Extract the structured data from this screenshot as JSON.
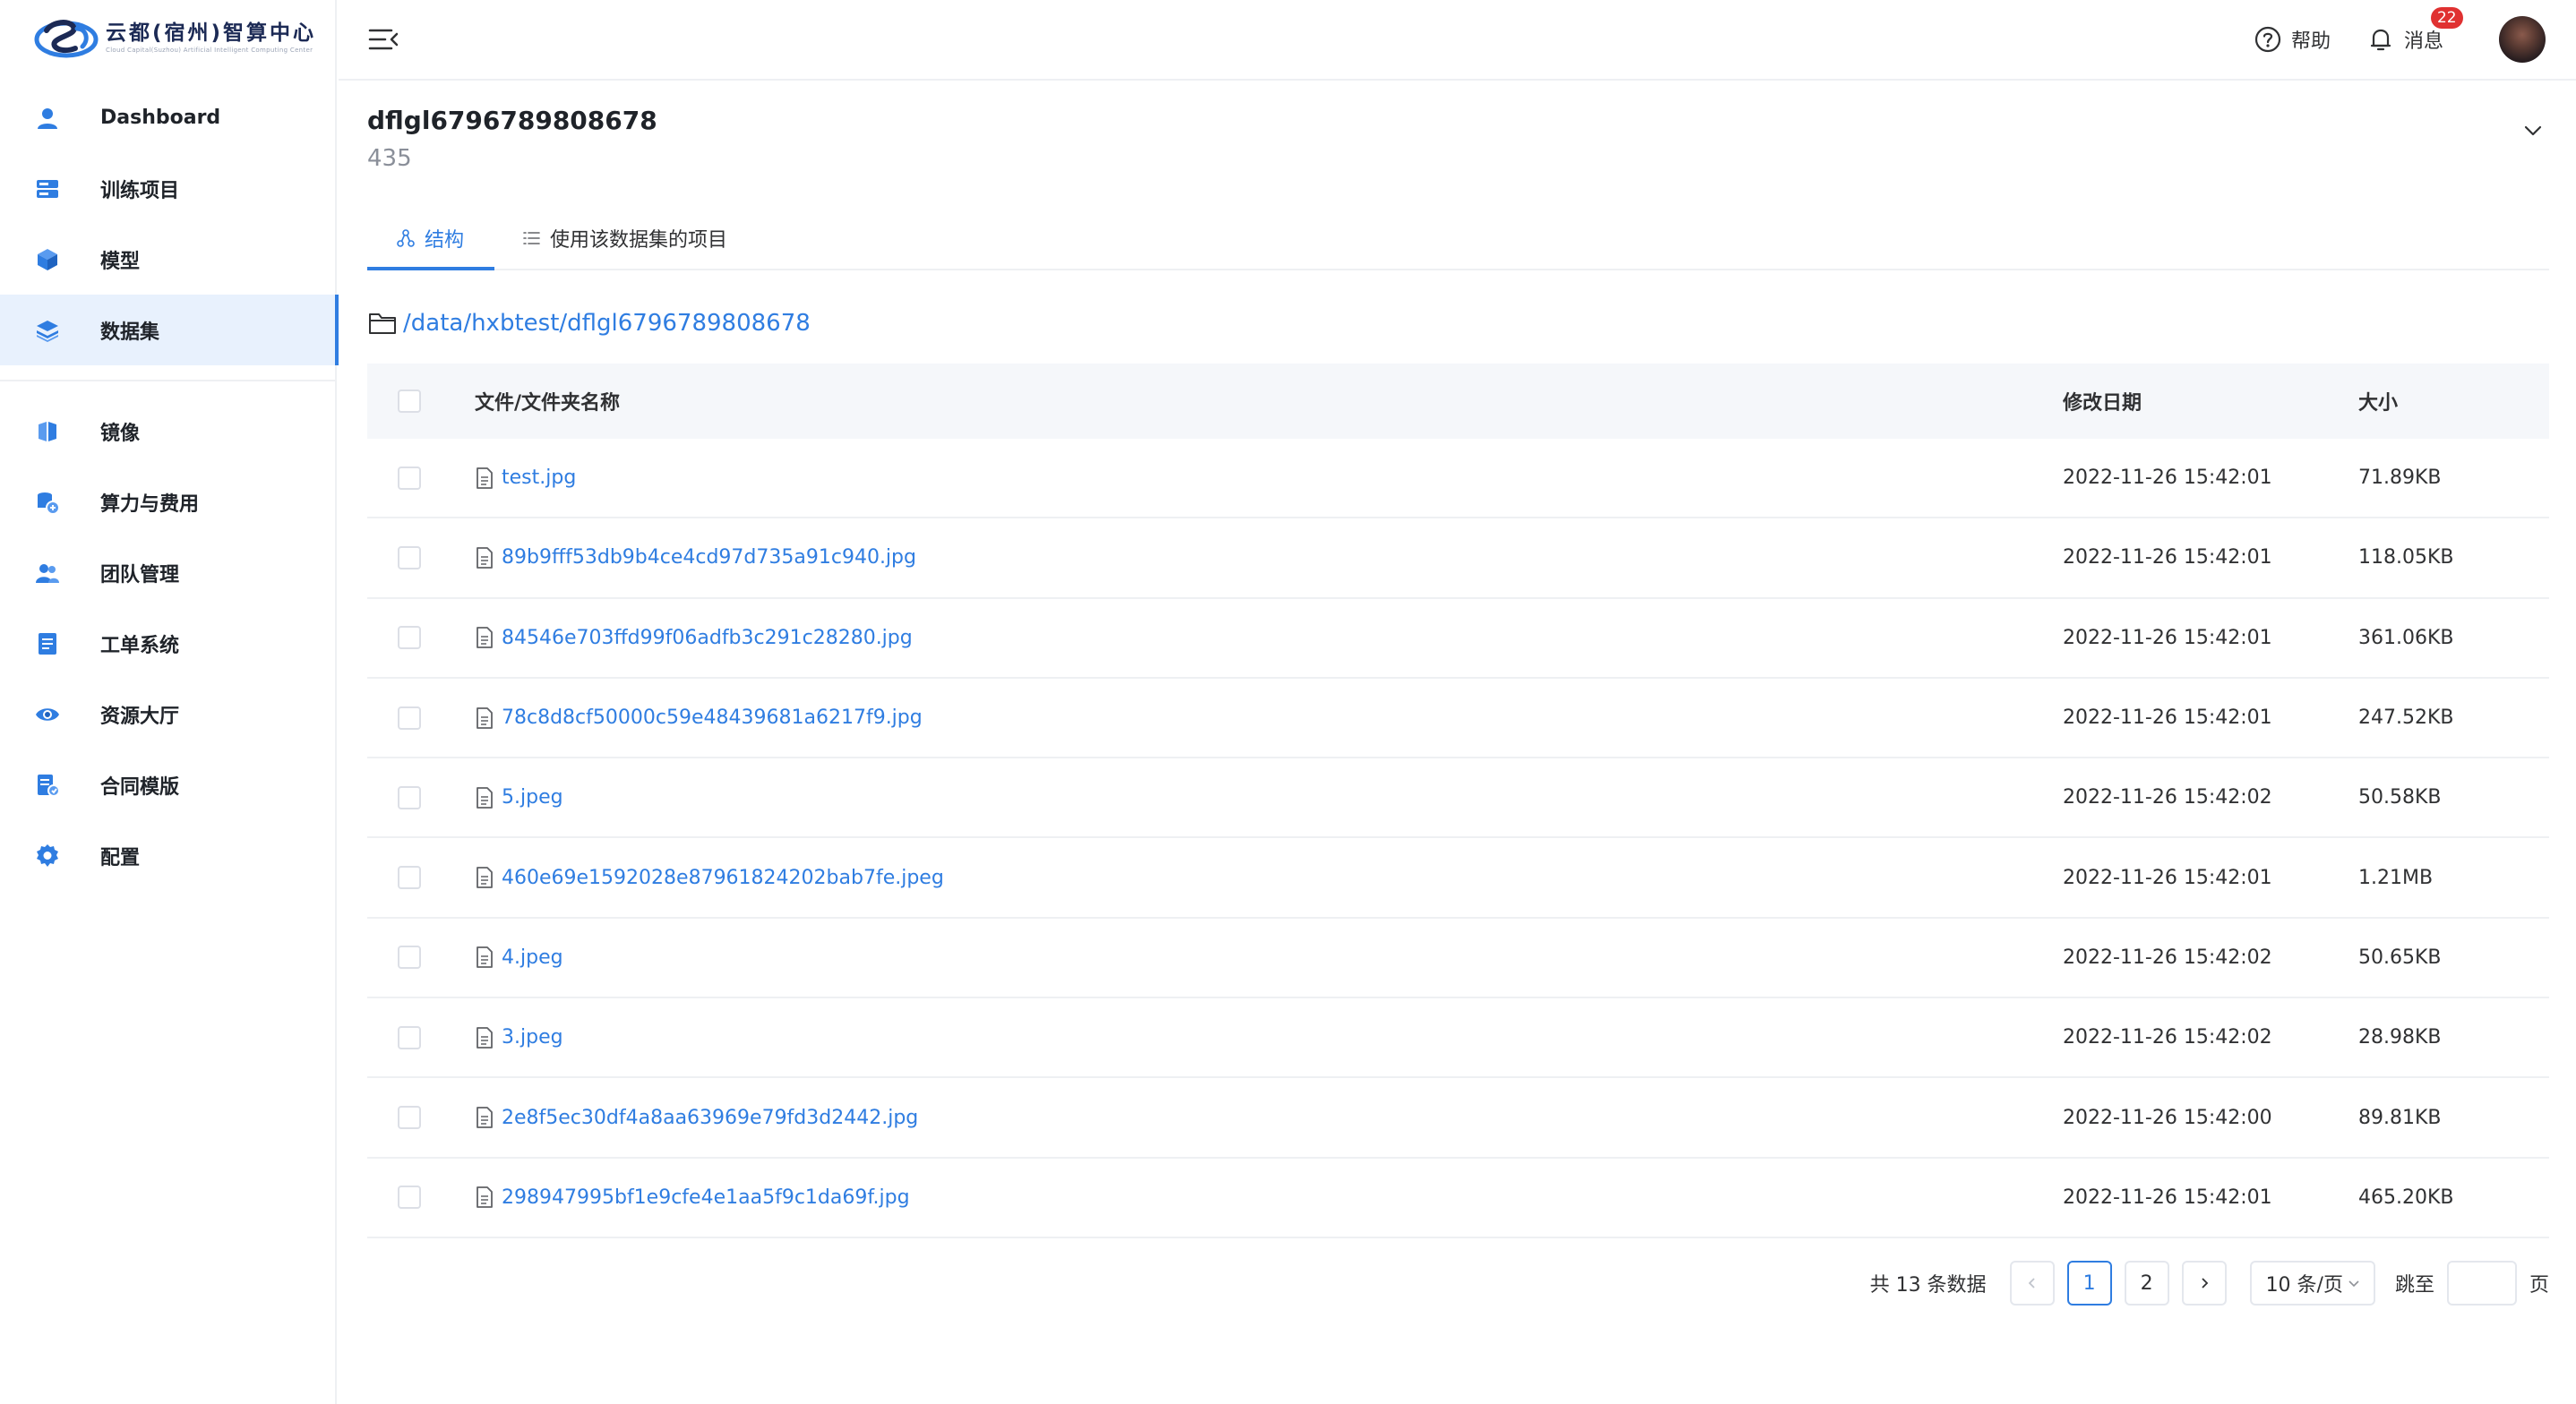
{
  "brand": {
    "title": "云都(宿州)智算中心",
    "subtitle": "Cloud Capital(Suzhou) Artificial Intelligent Computing Center"
  },
  "sidebar": {
    "items": [
      {
        "label": "Dashboard",
        "icon": "user-icon"
      },
      {
        "label": "训练项目",
        "icon": "server-icon"
      },
      {
        "label": "模型",
        "icon": "cube-icon"
      },
      {
        "label": "数据集",
        "icon": "layers-icon",
        "active": true
      },
      {
        "label": "镜像",
        "icon": "image-mirror-icon"
      },
      {
        "label": "算力与费用",
        "icon": "billing-icon"
      },
      {
        "label": "团队管理",
        "icon": "team-icon"
      },
      {
        "label": "工单系统",
        "icon": "ticket-icon"
      },
      {
        "label": "资源大厅",
        "icon": "eye-icon"
      },
      {
        "label": "合同模版",
        "icon": "contract-icon"
      },
      {
        "label": "配置",
        "icon": "gear-icon"
      }
    ]
  },
  "topbar": {
    "help_label": "帮助",
    "message_label": "消息",
    "message_count": "22"
  },
  "dataset": {
    "name": "dflgl6796789808678",
    "count": "435"
  },
  "tabs": [
    {
      "label": "结构",
      "active": true
    },
    {
      "label": "使用该数据集的项目",
      "active": false
    }
  ],
  "path": "/data/hxbtest/dflgl6796789808678",
  "table": {
    "headers": {
      "name": "文件/文件夹名称",
      "date": "修改日期",
      "size": "大小"
    },
    "rows": [
      {
        "name": "test.jpg",
        "date": "2022-11-26 15:42:01",
        "size": "71.89KB"
      },
      {
        "name": "89b9fff53db9b4ce4cd97d735a91c940.jpg",
        "date": "2022-11-26 15:42:01",
        "size": "118.05KB"
      },
      {
        "name": "84546e703ffd99f06adfb3c291c28280.jpg",
        "date": "2022-11-26 15:42:01",
        "size": "361.06KB"
      },
      {
        "name": "78c8d8cf50000c59e48439681a6217f9.jpg",
        "date": "2022-11-26 15:42:01",
        "size": "247.52KB"
      },
      {
        "name": "5.jpeg",
        "date": "2022-11-26 15:42:02",
        "size": "50.58KB"
      },
      {
        "name": "460e69e1592028e87961824202bab7fe.jpeg",
        "date": "2022-11-26 15:42:01",
        "size": "1.21MB"
      },
      {
        "name": "4.jpeg",
        "date": "2022-11-26 15:42:02",
        "size": "50.65KB"
      },
      {
        "name": "3.jpeg",
        "date": "2022-11-26 15:42:02",
        "size": "28.98KB"
      },
      {
        "name": "2e8f5ec30df4a8aa63969e79fd3d2442.jpg",
        "date": "2022-11-26 15:42:00",
        "size": "89.81KB"
      },
      {
        "name": "298947995bf1e9cfe4e1aa5f9c1da69f.jpg",
        "date": "2022-11-26 15:42:01",
        "size": "465.20KB"
      }
    ]
  },
  "pagination": {
    "total": "共 13 条数据",
    "prev": "<",
    "pages": [
      "1",
      "2"
    ],
    "current": "1",
    "next": ">",
    "page_size": "10 条/页",
    "jump_label": "跳至",
    "jump_unit": "页"
  },
  "colors": {
    "accent": "#2f7de1",
    "badge": "#e03131",
    "active_bg": "#e8f1fd"
  }
}
